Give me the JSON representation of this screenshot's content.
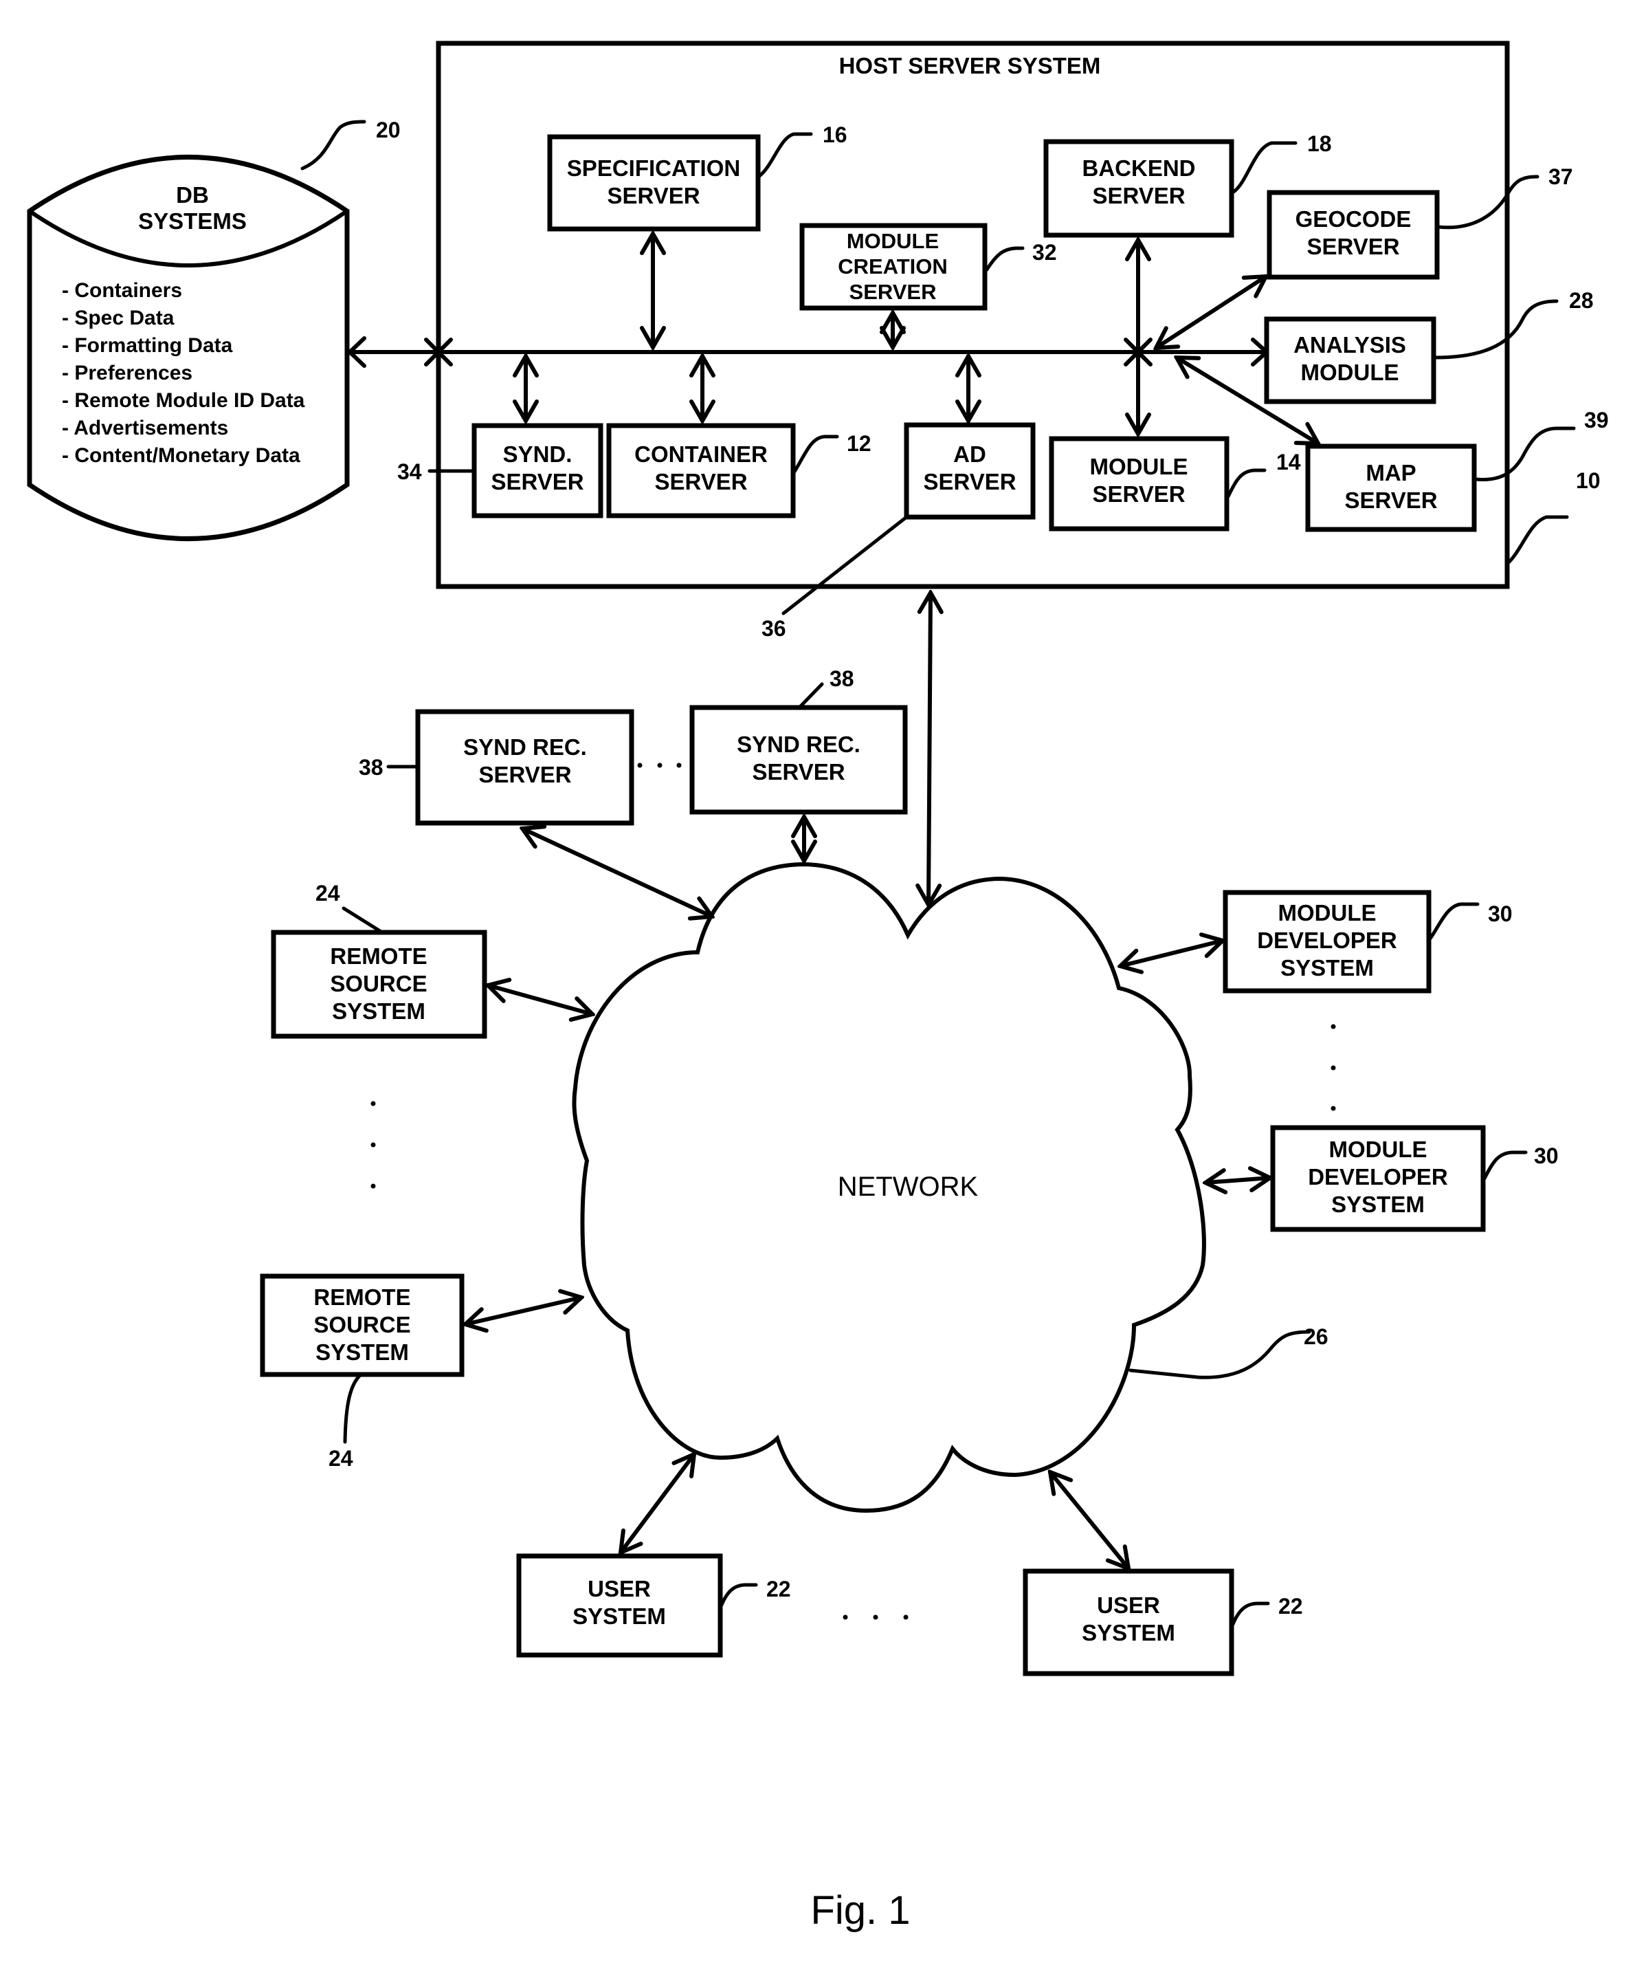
{
  "figure": {
    "caption": "Fig. 1",
    "host_system": {
      "title": "HOST SERVER SYSTEM",
      "ref": "10"
    },
    "db": {
      "title_line1": "DB",
      "title_line2": "SYSTEMS",
      "ref": "20",
      "items": [
        "- Containers",
        "- Spec Data",
        "- Formatting Data",
        "- Preferences",
        "- Remote Module ID Data",
        "- Advertisements",
        "- Content/Monetary Data"
      ]
    },
    "servers": {
      "specification": {
        "lines": [
          "SPECIFICATION",
          "SERVER"
        ],
        "ref": "16"
      },
      "module_creation": {
        "lines": [
          "MODULE",
          "CREATION",
          "SERVER"
        ],
        "ref": "32"
      },
      "backend": {
        "lines": [
          "BACKEND",
          "SERVER"
        ],
        "ref": "18"
      },
      "geocode": {
        "lines": [
          "GEOCODE",
          "SERVER"
        ],
        "ref": "37"
      },
      "analysis": {
        "lines": [
          "ANALYSIS",
          "MODULE"
        ],
        "ref": "28"
      },
      "synd": {
        "lines": [
          "SYND.",
          "SERVER"
        ],
        "ref": "34"
      },
      "container": {
        "lines": [
          "CONTAINER",
          "SERVER"
        ],
        "ref": "12"
      },
      "ad": {
        "lines": [
          "AD",
          "SERVER"
        ],
        "ref": "36"
      },
      "module": {
        "lines": [
          "MODULE",
          "SERVER"
        ],
        "ref": "14"
      },
      "map": {
        "lines": [
          "MAP",
          "SERVER"
        ],
        "ref": "39"
      }
    },
    "external": {
      "synd_rec_1": {
        "lines": [
          "SYND REC.",
          "SERVER"
        ],
        "ref": "38"
      },
      "synd_rec_2": {
        "lines": [
          "SYND REC.",
          "SERVER"
        ],
        "ref": "38"
      },
      "remote_source_1": {
        "lines": [
          "REMOTE",
          "SOURCE",
          "SYSTEM"
        ],
        "ref": "24"
      },
      "remote_source_2": {
        "lines": [
          "REMOTE",
          "SOURCE",
          "SYSTEM"
        ],
        "ref": "24"
      },
      "module_dev_1": {
        "lines": [
          "MODULE",
          "DEVELOPER",
          "SYSTEM"
        ],
        "ref": "30"
      },
      "module_dev_2": {
        "lines": [
          "MODULE",
          "DEVELOPER",
          "SYSTEM"
        ],
        "ref": "30"
      },
      "user_1": {
        "lines": [
          "USER",
          "SYSTEM"
        ],
        "ref": "22"
      },
      "user_2": {
        "lines": [
          "USER",
          "SYSTEM"
        ],
        "ref": "22"
      }
    },
    "network": {
      "label": "NETWORK",
      "ref": "26"
    },
    "ellipsis": "· · ·"
  }
}
